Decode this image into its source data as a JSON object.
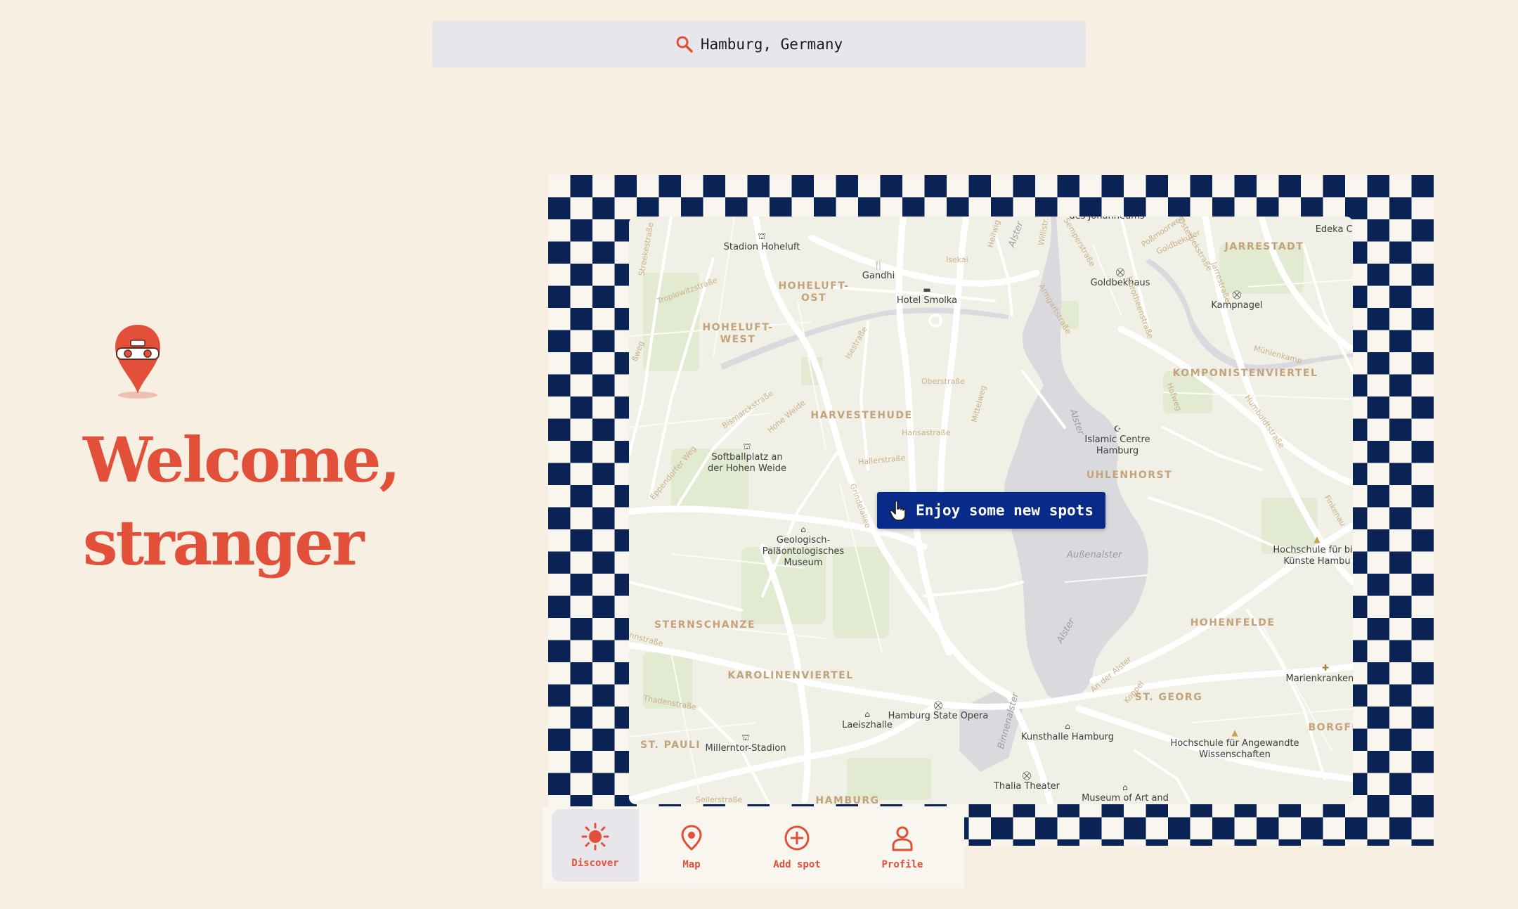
{
  "search": {
    "icon": "search-icon",
    "value": "Hamburg, Germany",
    "accent": "#e2503a"
  },
  "logo": {
    "icon": "skateboard-pin-icon"
  },
  "welcome": {
    "line1": "Welcome,",
    "line2": "stranger",
    "color": "#e2503a"
  },
  "map": {
    "districts": {
      "hoheluft_ost": "HOHELUFT-\nOST",
      "hoheluft_west": "HOHELUFT-\nWEST",
      "harvestehude": "HARVESTEHUDE",
      "jarrestadt": "JARRESTADT",
      "komponistenviertel": "KOMPONISTENVIERTEL",
      "uhlenhorst": "UHLENHORST",
      "sternschanze": "STERNSCHANZE",
      "karolinenviertel": "KAROLINENVIERTEL",
      "st_pauli": "ST. PAULI",
      "hohenfelde": "HOHENFELDE",
      "st_georg": "ST. GEORG",
      "borgfelde": "BORGFE",
      "hamburg": "HAMBURG"
    },
    "pois": {
      "stadion_hoheluft": "Stadion Hoheluft",
      "gandhi": "Gandhi",
      "hotel_smolka": "Hotel Smolka",
      "goldbekhaus": "Goldbekhaus",
      "kampnagel": "Kampnagel",
      "edeka": "Edeka Cl",
      "islamic_centre": "Islamic Centre\nHamburg",
      "softballplatz": "Softballplatz an\nder Hohen Weide",
      "geologisch": "Geologisch-\nPaläontologisches\nMuseum",
      "hochschule_bild": "Hochschule für bild\nKünste Hambu",
      "marienkrankenhaus": "Marienkrankenha",
      "laeiszhalle": "Laeiszhalle",
      "state_opera": "Hamburg State Opera",
      "kunsthalle": "Kunsthalle Hamburg",
      "hochschule_angewandte": "Hochschule für Angewandte\nWissenschaften",
      "millerntor": "Millerntor-Stadion",
      "thalia": "Thalia Theater",
      "museum_art": "Museum of Art and",
      "top_cut": "des Johanneums"
    },
    "water": {
      "aussenalster": "Außenalster",
      "alster1": "Alster",
      "alster2": "Alster",
      "alster3": "Alster",
      "binnenalster": "Binnenalster"
    },
    "streets": {
      "s1": "Troplowitzstraße",
      "s2": "Isekai",
      "s3": "Oberstraße",
      "s4": "Hansastraße",
      "s5": "Hallerstraße",
      "s6": "Grindelallee",
      "s7": "Mittelweg",
      "s8": "Bismarckstraße",
      "s9": "Hohe Weide",
      "s10": "Eppendorfer Weg",
      "s11": "Heilwig",
      "s12": "Semperstraße",
      "s13": "Goldbekufer",
      "s14": "Jarrestraße",
      "s15": "Hofweg",
      "s16": "Humboldtstraße",
      "s17": "An der Alster",
      "s18": "Koppel",
      "s19": "Thadenstraße",
      "s20": "Seilerstraße",
      "s21": "Finkenau",
      "s22": "Isestraße",
      "s23": "Streekestraße",
      "s24": "Osterbekstraße",
      "s25": "Dorotheenstraße",
      "s26": "Mühlenkamp",
      "s27": "Poßmoorweg",
      "s28": "Armgartstraße",
      "s29": "Willistr.",
      "s30": "nnstraße",
      "s31": "ßweg"
    }
  },
  "cta": {
    "icon": "hand-pointer-icon",
    "label": "Enjoy some new spots",
    "color": "#0a2a8a"
  },
  "nav": {
    "items": [
      {
        "icon": "sun-icon",
        "label": "Discover",
        "active": true
      },
      {
        "icon": "map-pin-icon",
        "label": "Map",
        "active": false
      },
      {
        "icon": "plus-circle-icon",
        "label": "Add spot",
        "active": false
      },
      {
        "icon": "person-icon",
        "label": "Profile",
        "active": false
      }
    ]
  }
}
